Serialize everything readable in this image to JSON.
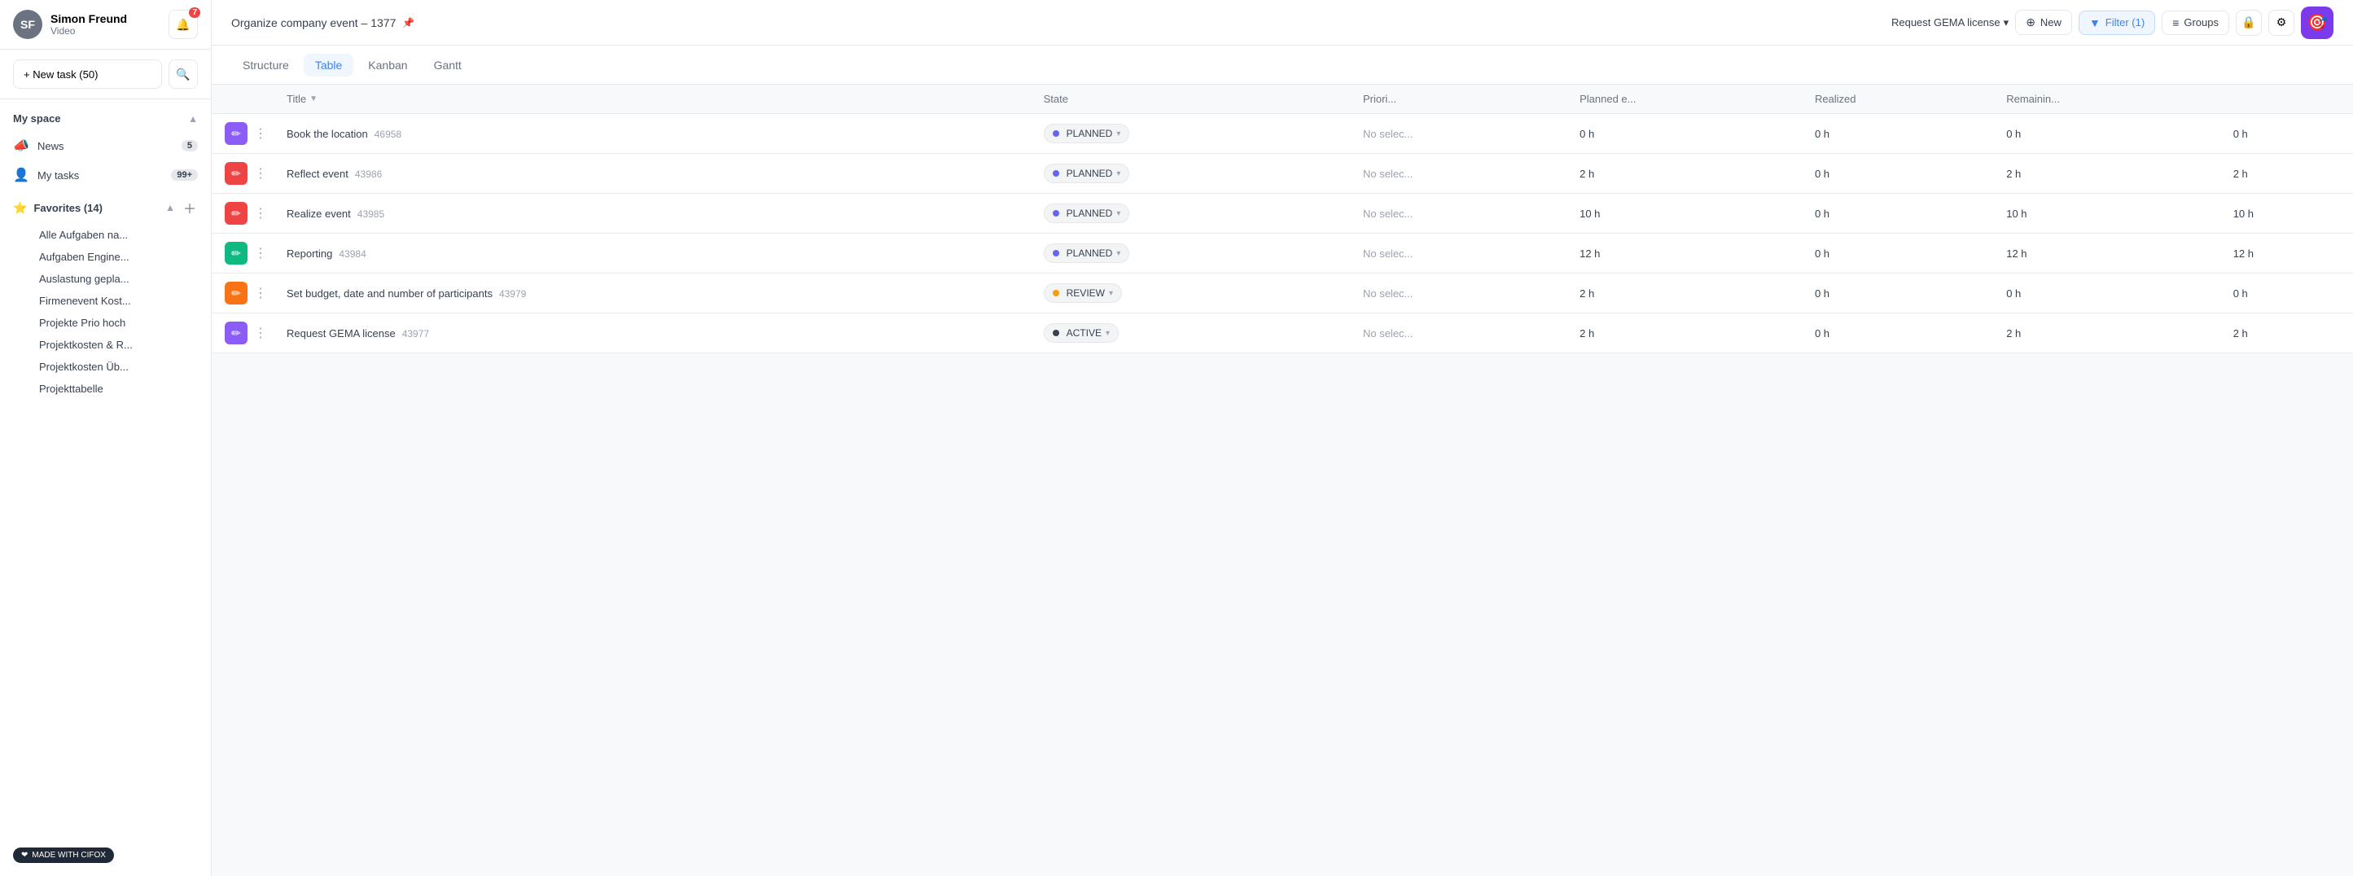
{
  "sidebar": {
    "user": {
      "name": "Simon Freund",
      "subtitle": "Video",
      "avatar_initials": "SF",
      "notification_count": "7"
    },
    "new_task_label": "+ New task (50)",
    "my_space_label": "My space",
    "nav_items": [
      {
        "id": "news",
        "label": "News",
        "icon": "📣",
        "badge": "5"
      },
      {
        "id": "my-tasks",
        "label": "My tasks",
        "icon": "👤",
        "badge": "99+"
      }
    ],
    "favorites": {
      "label": "Favorites (14)",
      "count": 14,
      "items": [
        "Alle Aufgaben na...",
        "Aufgaben Engine...",
        "Auslastung gepla...",
        "Firmenevent Kost...",
        "Projekte Prio hoch",
        "Projektkosten & R...",
        "Projektkosten Üb...",
        "Projekttabelle"
      ]
    }
  },
  "topbar": {
    "title": "Organize company event – 1377",
    "pin_icon": "📌",
    "request_link": "Request GEMA license",
    "request_chevron": "▾",
    "new_label": "New",
    "filter_label": "Filter (1)",
    "groups_label": "Groups",
    "lock_icon": "🔒",
    "settings_icon": "⚙"
  },
  "tabs": [
    {
      "id": "structure",
      "label": "Structure"
    },
    {
      "id": "table",
      "label": "Table"
    },
    {
      "id": "kanban",
      "label": "Kanban"
    },
    {
      "id": "gantt",
      "label": "Gantt"
    }
  ],
  "active_tab": "table",
  "table": {
    "columns": [
      {
        "id": "title",
        "label": "Title"
      },
      {
        "id": "state",
        "label": "State"
      },
      {
        "id": "priority",
        "label": "Priori..."
      },
      {
        "id": "planned_e",
        "label": "Planned e..."
      },
      {
        "id": "realized",
        "label": "Realized"
      },
      {
        "id": "remaining",
        "label": "Remainin..."
      },
      {
        "id": "f",
        "label": ""
      }
    ],
    "rows": [
      {
        "id": "46958",
        "icon_color": "purple",
        "icon": "✏",
        "title": "Book the location",
        "state": "PLANNED",
        "state_type": "planned",
        "priority": "No selec...",
        "planned_e": "0 h",
        "realized": "0 h",
        "remaining": "0 h",
        "extra": "0 h"
      },
      {
        "id": "43986",
        "icon_color": "red",
        "icon": "✏",
        "title": "Reflect event",
        "state": "PLANNED",
        "state_type": "planned",
        "priority": "No selec...",
        "planned_e": "2 h",
        "realized": "0 h",
        "remaining": "2 h",
        "extra": "2 h"
      },
      {
        "id": "43985",
        "icon_color": "red",
        "icon": "✏",
        "title": "Realize event",
        "state": "PLANNED",
        "state_type": "planned",
        "priority": "No selec...",
        "planned_e": "10 h",
        "realized": "0 h",
        "remaining": "10 h",
        "extra": "10 h"
      },
      {
        "id": "43984",
        "icon_color": "green",
        "icon": "✏",
        "title": "Reporting",
        "state": "PLANNED",
        "state_type": "planned",
        "priority": "No selec...",
        "planned_e": "12 h",
        "realized": "0 h",
        "remaining": "12 h",
        "extra": "12 h"
      },
      {
        "id": "43979",
        "icon_color": "orange",
        "icon": "✏",
        "title": "Set budget, date and number of participants",
        "state": "REVIEW",
        "state_type": "review",
        "priority": "No selec...",
        "planned_e": "2 h",
        "realized": "0 h",
        "remaining": "0 h",
        "extra": "0 h"
      },
      {
        "id": "43977",
        "icon_color": "purple",
        "icon": "✏",
        "title": "Request GEMA license",
        "state": "ACTIVE",
        "state_type": "active",
        "priority": "No selec...",
        "planned_e": "2 h",
        "realized": "0 h",
        "remaining": "2 h",
        "extra": "2 h"
      }
    ]
  }
}
